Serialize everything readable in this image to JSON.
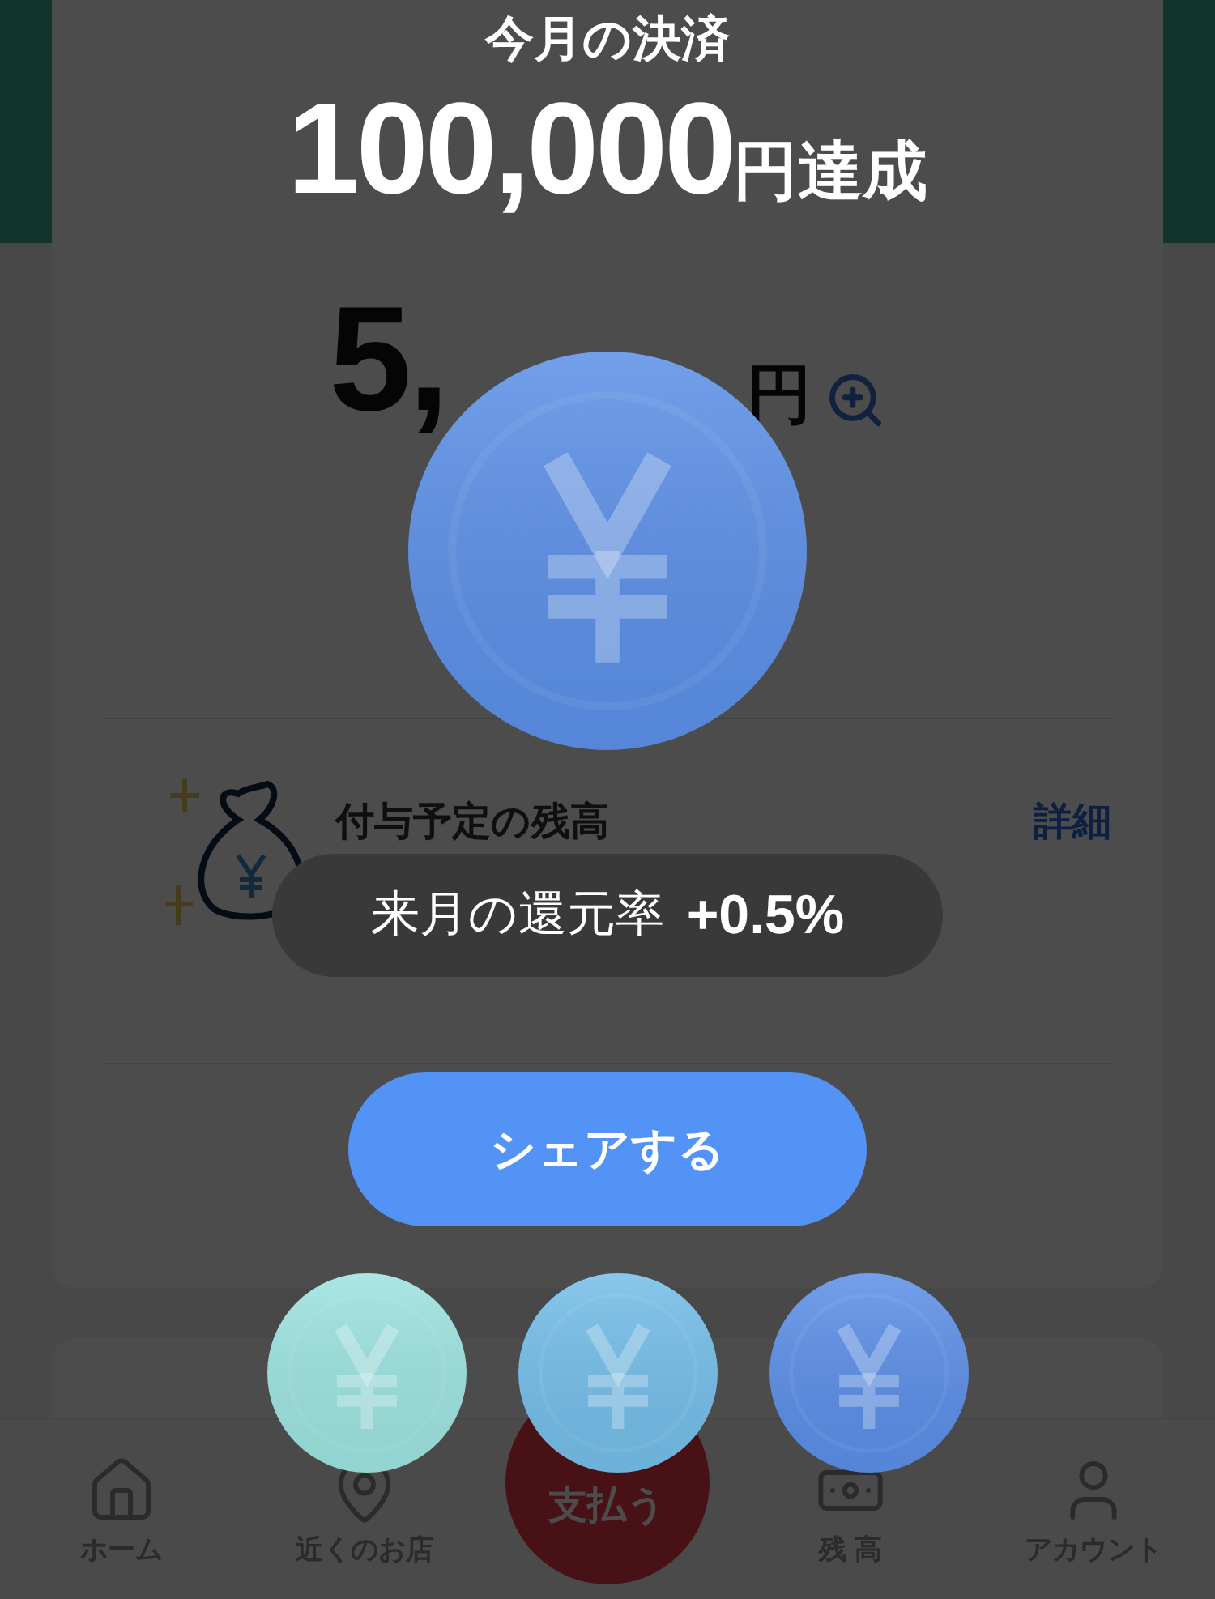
{
  "background": {
    "balance": "5,",
    "balance_unit": "円",
    "points_title": "付与予定の残高",
    "details_link": "詳細"
  },
  "tab_bar": [
    {
      "label": "ホーム",
      "kind": "home"
    },
    {
      "label": "近くのお店",
      "kind": "pin"
    },
    {
      "label": "支払う",
      "kind": "pay"
    },
    {
      "label": "残 高",
      "kind": "money"
    },
    {
      "label": "アカウント",
      "kind": "user"
    }
  ],
  "overlay": {
    "title": "今月の決済",
    "amount": "100,000",
    "amount_unit": "円達成",
    "rate_label": "来月の還元率",
    "rate_value": "+0.5%",
    "share_button": "シェアする",
    "coins": [
      {
        "kind": "large",
        "color": "#5b8fe6"
      },
      {
        "kind": "small",
        "color": "#9ce2df"
      },
      {
        "kind": "small",
        "color": "#74bde8"
      },
      {
        "kind": "small",
        "color": "#5b8ee6"
      }
    ]
  }
}
